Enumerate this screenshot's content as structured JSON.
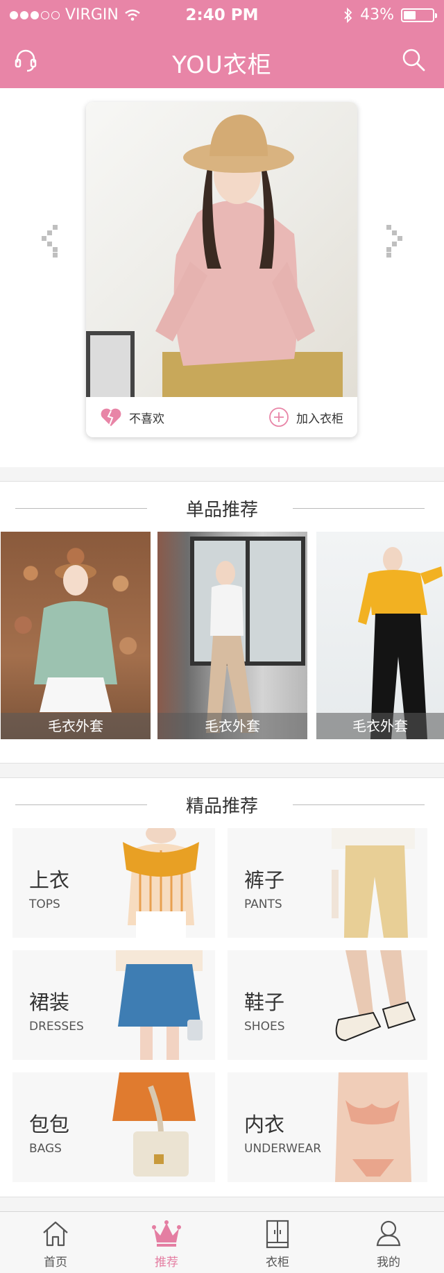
{
  "status_bar": {
    "carrier": "VIRGIN",
    "time": "2:40 PM",
    "battery": "43%",
    "battery_level": 0.43
  },
  "header": {
    "title": "YOU衣柜",
    "left_icon": "headset-icon",
    "right_icon": "search-icon"
  },
  "hero_card": {
    "dislike_label": "不喜欢",
    "add_label": "加入衣柜"
  },
  "singles": {
    "title": "单品推荐",
    "items": [
      {
        "caption": "毛衣外套"
      },
      {
        "caption": "毛衣外套"
      },
      {
        "caption": "毛衣外套"
      }
    ]
  },
  "boutique": {
    "title": "精品推荐",
    "categories": [
      {
        "cn": "上衣",
        "en": "TOPS"
      },
      {
        "cn": "裤子",
        "en": "PANTS"
      },
      {
        "cn": "裙装",
        "en": "DRESSES"
      },
      {
        "cn": "鞋子",
        "en": "SHOES"
      },
      {
        "cn": "包包",
        "en": "BAGS"
      },
      {
        "cn": "内衣",
        "en": "UNDERWEAR"
      }
    ]
  },
  "tabbar": {
    "active": "推荐",
    "tabs": [
      {
        "label": "首页",
        "icon": "home-icon"
      },
      {
        "label": "推荐",
        "icon": "crown-icon"
      },
      {
        "label": "衣柜",
        "icon": "wardrobe-icon"
      },
      {
        "label": "我的",
        "icon": "user-icon"
      }
    ]
  },
  "colors": {
    "brand_pink": "#e885a7",
    "active_tab": "#e47ea2"
  }
}
